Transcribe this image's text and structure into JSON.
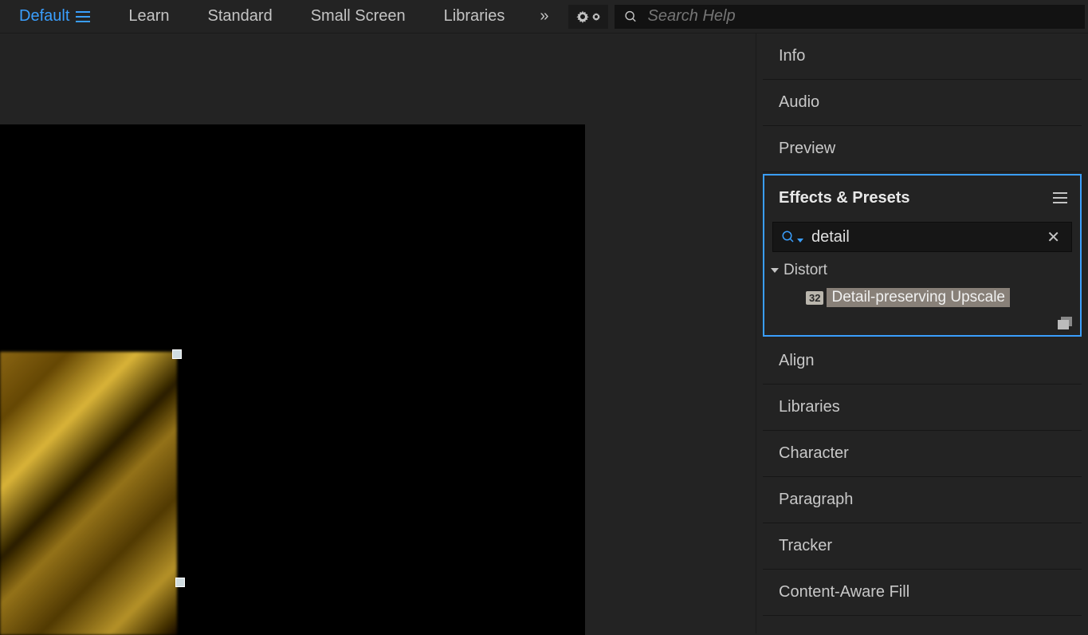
{
  "workspaces": {
    "items": [
      "Default",
      "Learn",
      "Standard",
      "Small Screen",
      "Libraries"
    ],
    "active_index": 0
  },
  "search_help": {
    "placeholder": "Search Help"
  },
  "panels": {
    "above": [
      "Info",
      "Audio",
      "Preview"
    ],
    "below": [
      "Align",
      "Libraries",
      "Character",
      "Paragraph",
      "Tracker",
      "Content-Aware Fill"
    ]
  },
  "effects_presets": {
    "title": "Effects & Presets",
    "search_value": "detail",
    "category": "Distort",
    "bit_badge": "32",
    "effect_name": "Detail-preserving Upscale"
  }
}
